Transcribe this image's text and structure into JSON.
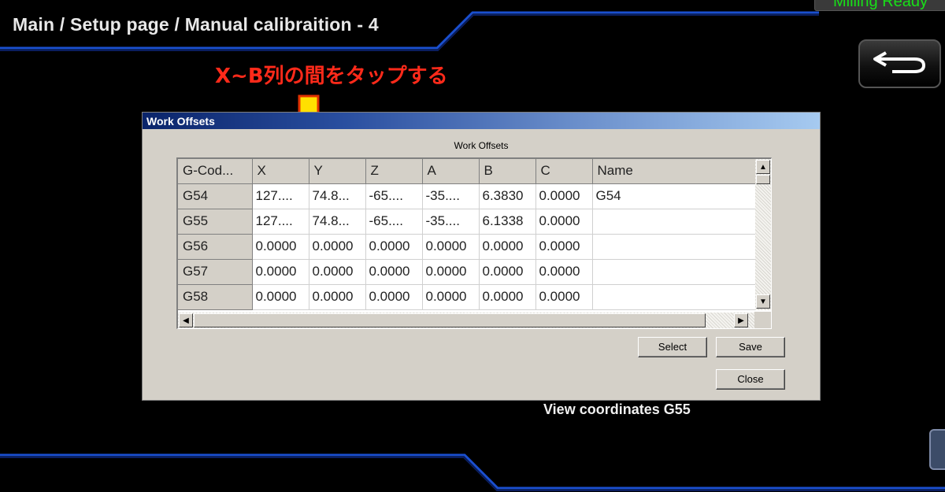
{
  "header": {
    "breadcrumb": "Main / Setup page / Manual calibraition - 4",
    "status": "Milling Ready"
  },
  "annotation": {
    "text": "X~B列の間をタップする",
    "color": "#ff2a1a",
    "arrow_color": "#ffe000"
  },
  "dialog": {
    "title": "Work Offsets",
    "group_label": "Work Offsets",
    "columns": [
      "G-Cod...",
      "X",
      "Y",
      "Z",
      "A",
      "B",
      "C",
      "Name"
    ],
    "rows": [
      [
        "G54",
        "127....",
        "74.8...",
        "-65....",
        "-35....",
        "6.3830",
        "0.0000",
        "G54"
      ],
      [
        "G55",
        "127....",
        "74.8...",
        "-65....",
        "-35....",
        "6.1338",
        "0.0000",
        ""
      ],
      [
        "G56",
        "0.0000",
        "0.0000",
        "0.0000",
        "0.0000",
        "0.0000",
        "0.0000",
        ""
      ],
      [
        "G57",
        "0.0000",
        "0.0000",
        "0.0000",
        "0.0000",
        "0.0000",
        "0.0000",
        ""
      ],
      [
        "G58",
        "0.0000",
        "0.0000",
        "0.0000",
        "0.0000",
        "0.0000",
        "0.0000",
        ""
      ]
    ],
    "buttons": {
      "select": "Select",
      "save": "Save",
      "close": "Close"
    }
  },
  "footer": {
    "view_coordinates": "View coordinates G55"
  },
  "icons": {
    "back": "back-arrow-icon"
  },
  "colors": {
    "accent_blue": "#1a6fff",
    "status_green": "#18e018"
  }
}
